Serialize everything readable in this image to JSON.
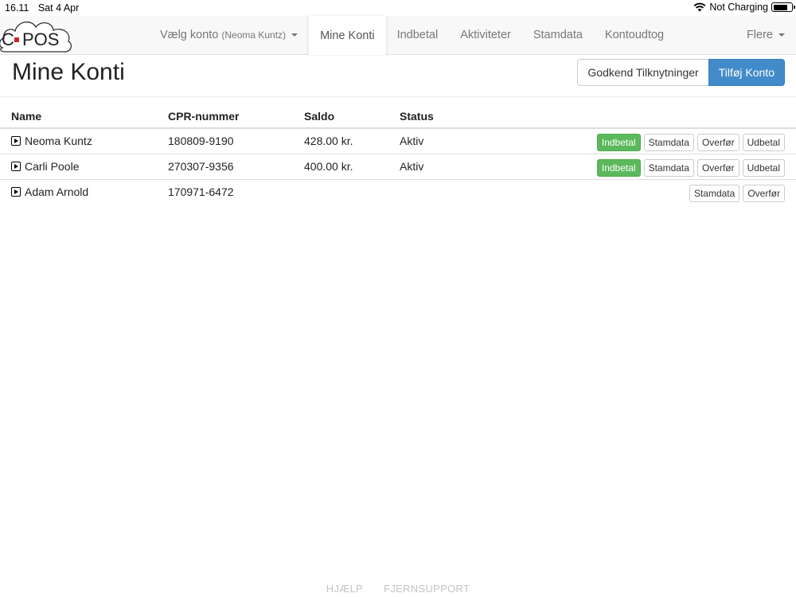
{
  "statusbar": {
    "time": "16.11",
    "date": "Sat 4 Apr",
    "charging": "Not Charging"
  },
  "logo": {
    "text_c": "C",
    "text_pos": "POS",
    "accent": "#c1272d"
  },
  "nav": {
    "account_label": "Vælg konto",
    "account_sub": "(Neoma Kuntz)",
    "items": [
      "Mine Konti",
      "Indbetal",
      "Aktiviteter",
      "Stamdata",
      "Kontoudtog"
    ],
    "more": "Flere"
  },
  "page": {
    "title": "Mine Konti",
    "approve_button": "Godkend Tilknytninger",
    "add_button": "Tilføj Konto"
  },
  "table": {
    "headers": {
      "name": "Name",
      "cpr": "CPR-nummer",
      "saldo": "Saldo",
      "status": "Status"
    },
    "rows": [
      {
        "name": "Neoma Kuntz",
        "cpr": "180809-9190",
        "saldo": "428.00 kr.",
        "status": "Aktiv",
        "actions": [
          "Indbetal",
          "Stamdata",
          "Overfør",
          "Udbetal"
        ]
      },
      {
        "name": "Carli Poole",
        "cpr": "270307-9356",
        "saldo": "400.00 kr.",
        "status": "Aktiv",
        "actions": [
          "Indbetal",
          "Stamdata",
          "Overfør",
          "Udbetal"
        ]
      },
      {
        "name": "Adam Arnold",
        "cpr": "170971-6472",
        "saldo": "",
        "status": "",
        "actions": [
          "Stamdata",
          "Overfør"
        ]
      }
    ]
  },
  "footer": {
    "help": "HJÆLP",
    "remote": "FJERNSUPPORT"
  },
  "colors": {
    "primary": "#428bca",
    "success": "#5cb85c"
  }
}
